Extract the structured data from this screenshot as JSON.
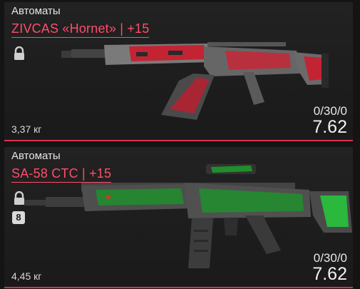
{
  "weapons": [
    {
      "category": "Автоматы",
      "name": "ZIVCAS «Hornet» | +15",
      "locked": true,
      "weight": "3,37 кг",
      "ammo": "0/30/0",
      "caliber": "7.62",
      "skin_color": "#d2283a"
    },
    {
      "category": "Автоматы",
      "name": "SA-58 CTC | +15",
      "locked": true,
      "badge": "8",
      "weight": "4,45 кг",
      "ammo": "0/30/0",
      "caliber": "7.62",
      "skin_color": "#22d33a"
    }
  ],
  "colors": {
    "accent": "#ff4d6a",
    "card_border": "#d9304a"
  }
}
